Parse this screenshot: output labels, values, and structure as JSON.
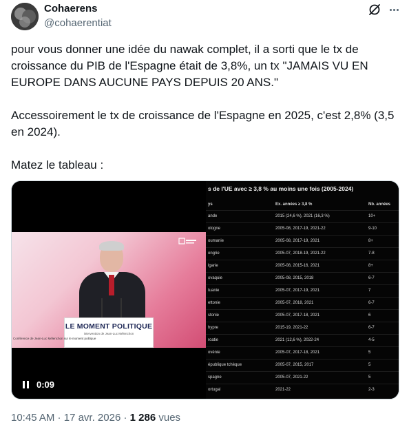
{
  "author": {
    "name": "Cohaerens",
    "handle": "@cohaerentiat"
  },
  "tweet": {
    "paragraphs": [
      "pour vous donner une idée du nawak complet, il a sorti que le tx de croissance du PIB de l'Espagne était de 3,8%, un tx \"JAMAIS VU EN EUROPE DANS AUCUNE PAYS DEPUIS 20 ANS.\"",
      "Accessoirement le tx de croissance de l'Espagne en 2025, c'est 2,8% (3,5 en 2024).",
      "Matez le tableau :"
    ]
  },
  "video": {
    "podium_title": "LE MOMENT POLITIQUE",
    "podium_subtitle": "intervention de Jean-Luc Mélenchon",
    "caption": "Conférence de Jean-Luc Mélenchon sur le moment politique",
    "time": "0:09"
  },
  "table": {
    "title": "s de l'UE avec ≥ 3,8 % au moins une fois (2005-2024)",
    "headers": [
      "ys",
      "Ex. années ≥ 3,8 %",
      "Nb. années"
    ],
    "rows": [
      {
        "country": "ande",
        "years": "2015 (24,6 %), 2021 (16,3 %)",
        "count": "10+"
      },
      {
        "country": "ologne",
        "years": "2005-08, 2017-19, 2021-22",
        "count": "9-10"
      },
      {
        "country": "oumanie",
        "years": "2005-08, 2017-19, 2021",
        "count": "8+"
      },
      {
        "country": "ongrie",
        "years": "2005-07, 2018-19, 2021-22",
        "count": "7-8"
      },
      {
        "country": "lgarie",
        "years": "2005-08, 2015-16, 2021",
        "count": "8+"
      },
      {
        "country": "ovaquie",
        "years": "2005-08, 2015, 2018",
        "count": "6-7"
      },
      {
        "country": "tuanie",
        "years": "2005-07, 2017-19, 2021",
        "count": "7"
      },
      {
        "country": "ettonie",
        "years": "2005-07, 2018, 2021",
        "count": "6-7"
      },
      {
        "country": "stonie",
        "years": "2005-07, 2017-18, 2021",
        "count": "6"
      },
      {
        "country": "hypre",
        "years": "2015-19, 2021-22",
        "count": "6-7"
      },
      {
        "country": "roatie",
        "years": "2021 (12,6 %), 2022-24",
        "count": "4-5"
      },
      {
        "country": "ovénie",
        "years": "2005-07, 2017-18, 2021",
        "count": "5"
      },
      {
        "country": "épublique tchèque",
        "years": "2005-07, 2015, 2017",
        "count": "5"
      },
      {
        "country": "spagne",
        "years": "2005-07, 2021-22",
        "count": "5"
      },
      {
        "country": "ortugal",
        "years": "2021-22",
        "count": "2-3"
      }
    ]
  },
  "footer": {
    "time": "10:45 AM",
    "separator": " · ",
    "date": "17 avr. 2026",
    "views_count": "1 286",
    "views_label": " vues"
  },
  "icons": {
    "grok": "grok-icon",
    "more": "more-icon",
    "pause": "pause-icon"
  },
  "colors": {
    "text": "#0f1419",
    "secondary": "#536471",
    "media_bg": "#000000",
    "podium_title": "#1d2755"
  }
}
